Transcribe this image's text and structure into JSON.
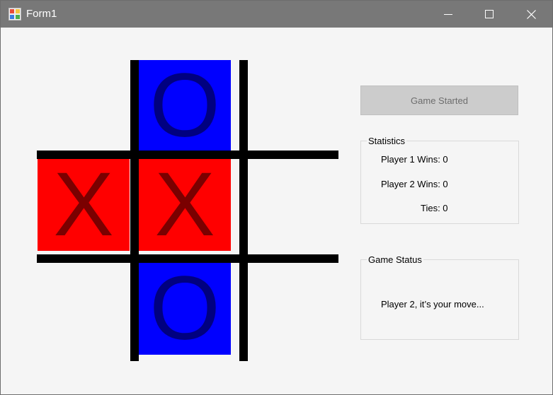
{
  "window": {
    "title": "Form1"
  },
  "board": {
    "colors": {
      "x_bg": "#ff0000",
      "o_bg": "#0000ff",
      "x_mark": "#7a0000",
      "o_mark": "#000080",
      "grid": "#000000"
    },
    "cells": [
      {
        "mark": "",
        "owner": "empty"
      },
      {
        "mark": "O",
        "owner": "o"
      },
      {
        "mark": "",
        "owner": "empty"
      },
      {
        "mark": "X",
        "owner": "x"
      },
      {
        "mark": "X",
        "owner": "x"
      },
      {
        "mark": "",
        "owner": "empty"
      },
      {
        "mark": "",
        "owner": "empty"
      },
      {
        "mark": "O",
        "owner": "o"
      },
      {
        "mark": "",
        "owner": "empty"
      }
    ]
  },
  "controls": {
    "start_button": "Game Started",
    "start_enabled": false
  },
  "statistics": {
    "title": "Statistics",
    "player1": "Player 1 Wins: 0",
    "player2": "Player 2 Wins: 0",
    "ties": "Ties: 0"
  },
  "status": {
    "title": "Game Status",
    "message": "Player 2, it’s your move..."
  }
}
